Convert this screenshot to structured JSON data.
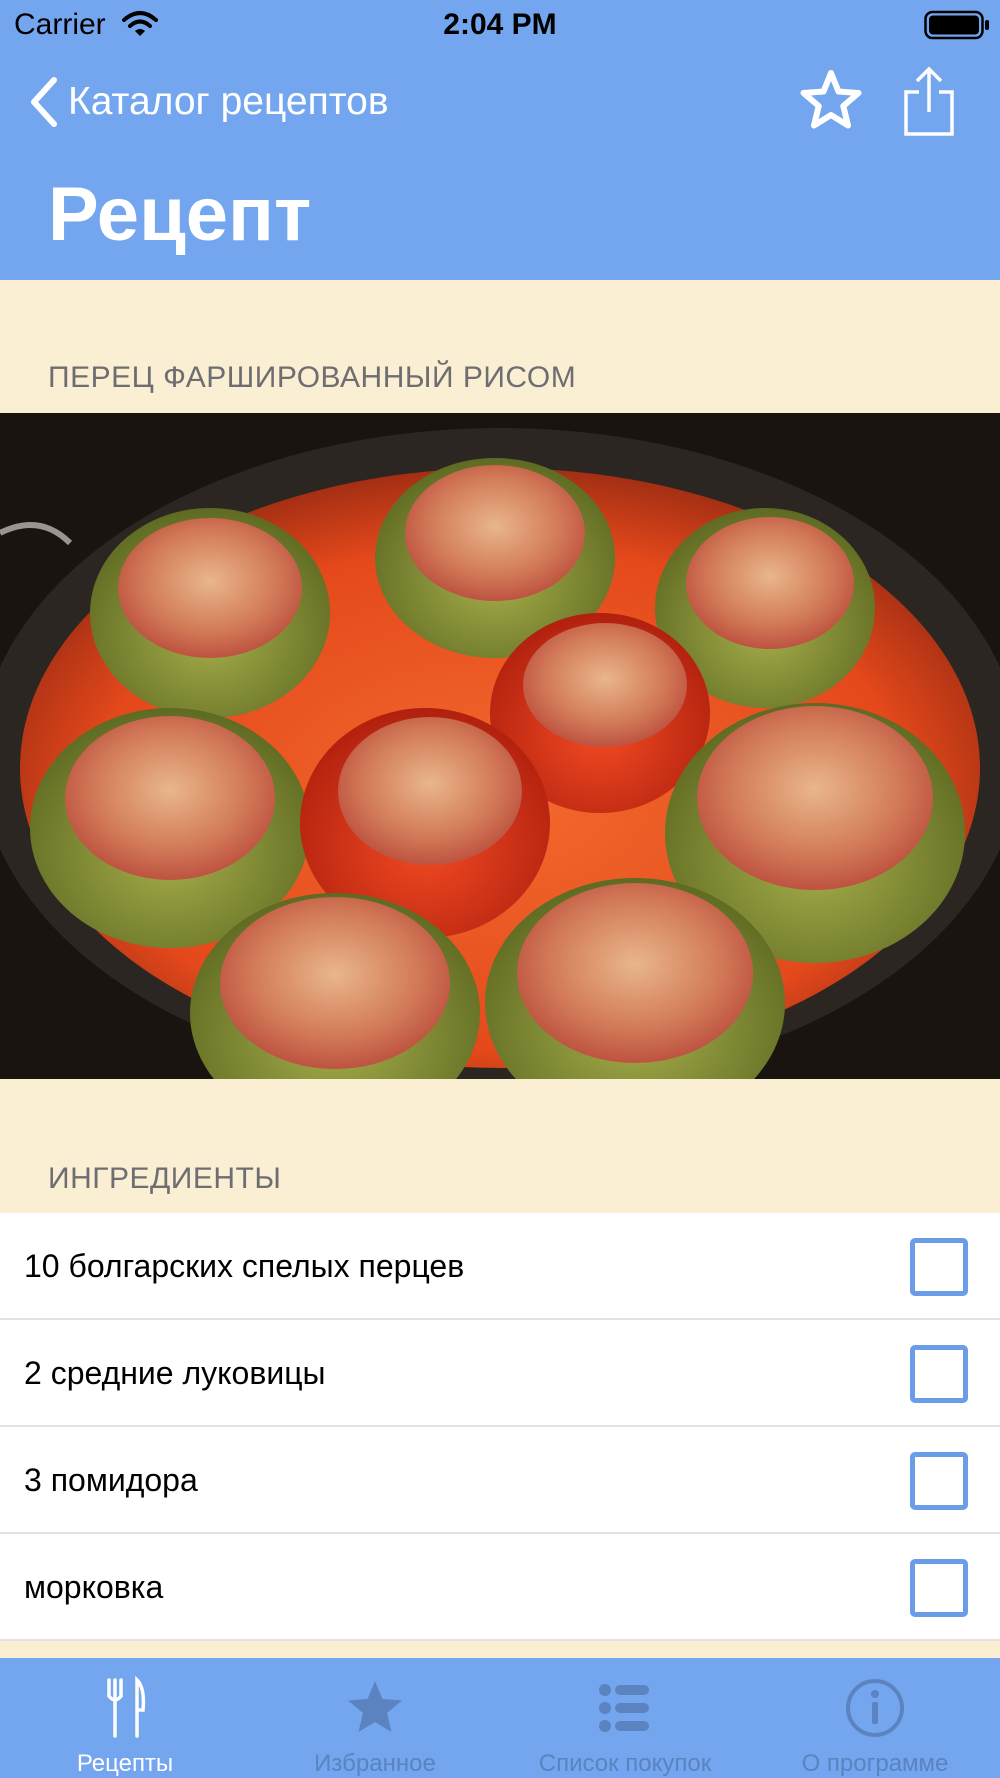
{
  "status_bar": {
    "carrier": "Carrier",
    "time": "2:04 PM"
  },
  "nav": {
    "back_label": "Каталог рецептов",
    "title": "Рецепт",
    "favorite_icon": "star-outline-icon",
    "share_icon": "share-icon"
  },
  "recipe": {
    "name": "ПЕРЕЦ ФАРШИРОВАННЫЙ РИСОМ"
  },
  "ingredients": {
    "header": "ИНГРЕДИЕНТЫ",
    "items": [
      {
        "label": "10 болгарских спелых перцев",
        "checked": false
      },
      {
        "label": "2 средние луковицы",
        "checked": false
      },
      {
        "label": "3 помидора",
        "checked": false
      },
      {
        "label": "морковка",
        "checked": false
      }
    ]
  },
  "tabbar": {
    "tabs": [
      {
        "label": "Рецепты",
        "icon": "fork-knife-icon",
        "active": true
      },
      {
        "label": "Избранное",
        "icon": "star-icon",
        "active": false
      },
      {
        "label": "Список покупок",
        "icon": "list-icon",
        "active": false
      },
      {
        "label": "О программе",
        "icon": "info-icon",
        "active": false
      }
    ]
  },
  "colors": {
    "accent": "#73A6EE",
    "background": "#FAEED3",
    "checkbox": "#6B9CE8",
    "inactive_tab": "#5A83C0"
  }
}
